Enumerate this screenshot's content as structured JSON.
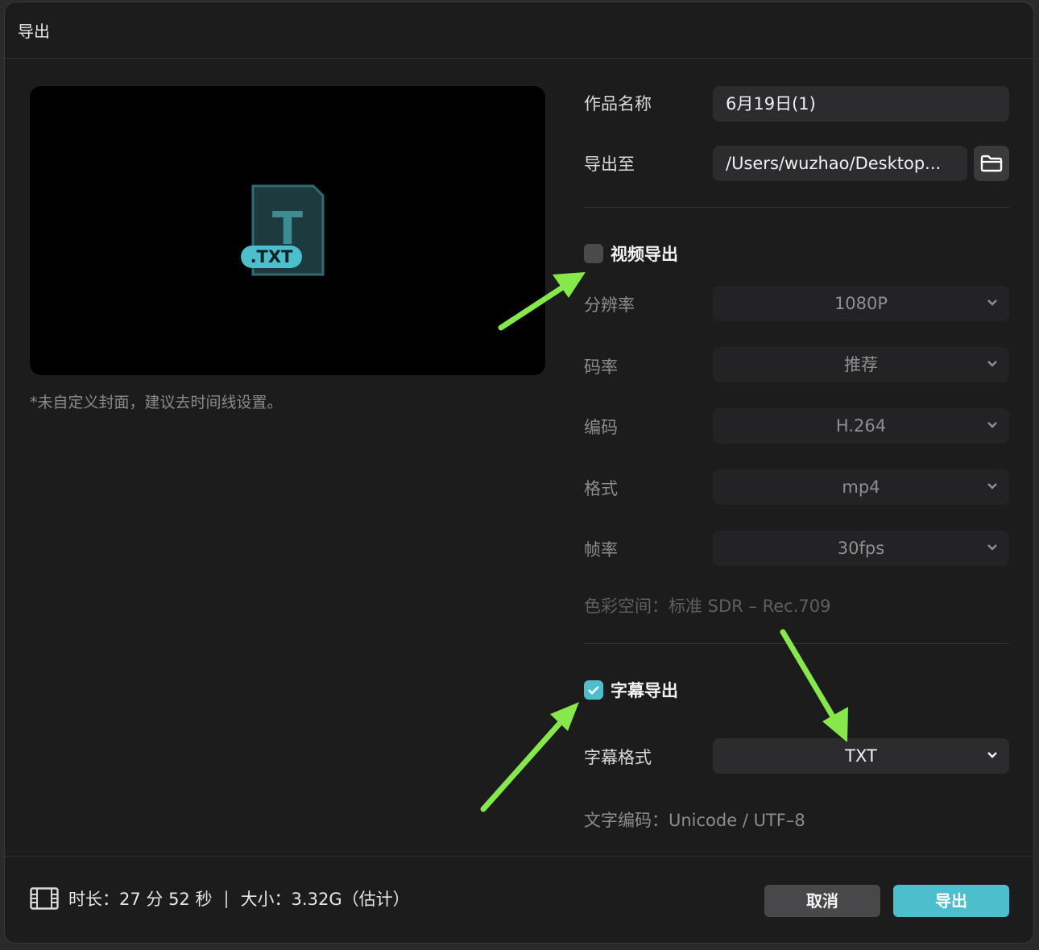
{
  "window": {
    "title": "导出"
  },
  "preview": {
    "icon_label": ".TXT",
    "icon_letter": "T",
    "cover_note": "*未自定义封面，建议去时间线设置。"
  },
  "fields": {
    "name_label": "作品名称",
    "name_value": "6月19日(1)",
    "export_to_label": "导出至",
    "export_to_value": "/Users/wuzhao/Desktop..."
  },
  "video_export": {
    "label": "视频导出",
    "checked": false,
    "resolution": {
      "label": "分辨率",
      "value": "1080P"
    },
    "bitrate": {
      "label": "码率",
      "value": "推荐"
    },
    "codec": {
      "label": "编码",
      "value": "H.264"
    },
    "format": {
      "label": "格式",
      "value": "mp4"
    },
    "framerate": {
      "label": "帧率",
      "value": "30fps"
    },
    "color_space": "色彩空间：标准 SDR – Rec.709"
  },
  "subtitle_export": {
    "label": "字幕导出",
    "checked": true,
    "format": {
      "label": "字幕格式",
      "value": "TXT"
    },
    "encoding": "文字编码：Unicode / UTF–8"
  },
  "footer": {
    "duration": "时长：27 分 52 秒",
    "separator": "|",
    "size": "大小：3.32G（估计）",
    "cancel_label": "取消",
    "export_label": "导出"
  },
  "colors": {
    "accent": "#4dbecb",
    "annotation": "#86e84a"
  }
}
